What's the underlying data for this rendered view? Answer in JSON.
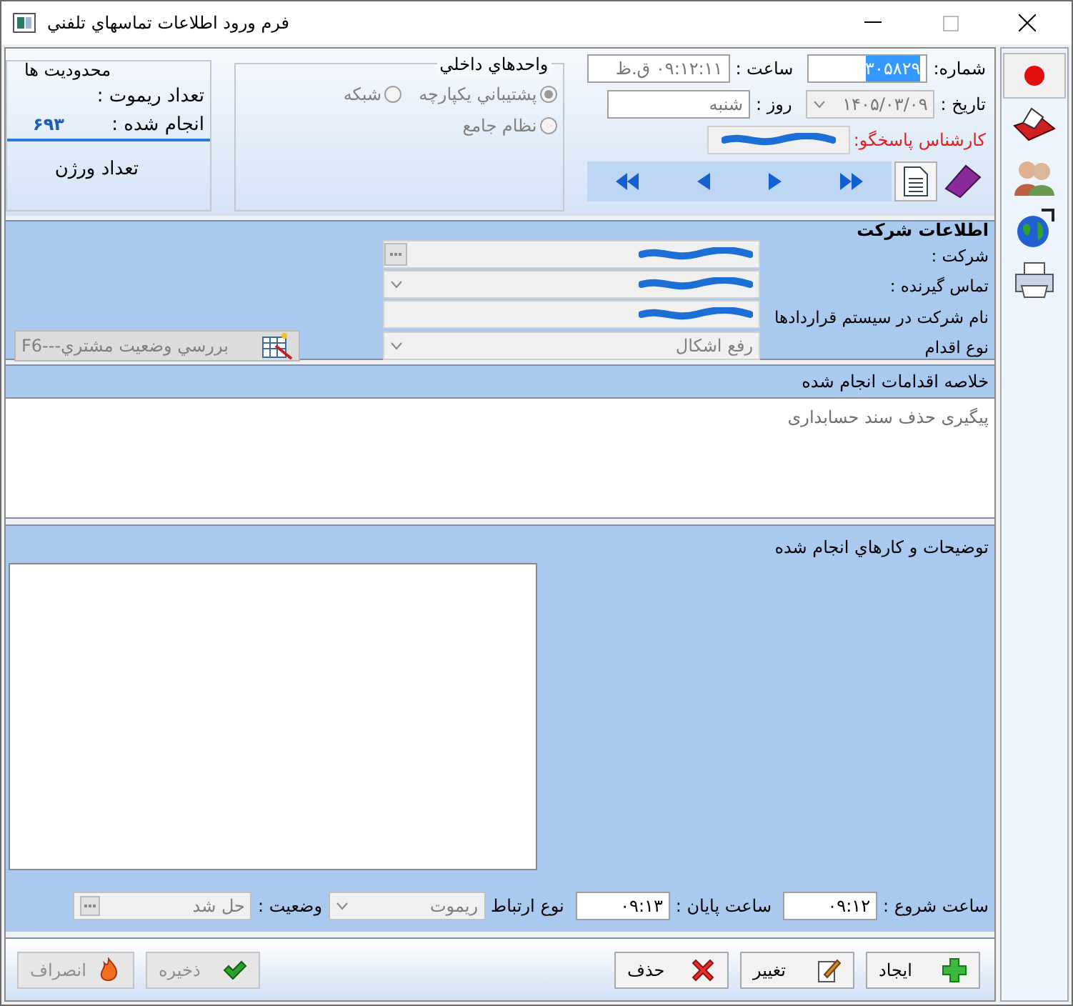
{
  "window": {
    "title": "فرم ورود اطلاعات تماسهاي تلفني"
  },
  "header": {
    "number_label": "شماره:",
    "number": "۳۰۵۸۲۹",
    "time_label": "ساعت :",
    "time": "۰۹:۱۲:۱۱ ق.ظ",
    "date_label": "تاريخ :",
    "date": "۱۴۰۵/۰۳/۰۹",
    "day_label": "روز :",
    "day": "شنبه",
    "expert_label": "كارشناس پاسخگو:"
  },
  "units": {
    "title": "واحدهاي داخلي",
    "options": [
      {
        "label": "پشتيباني يكپارچه",
        "selected": true
      },
      {
        "label": "شبكه",
        "selected": false
      },
      {
        "label": "نظام جامع",
        "selected": false
      }
    ]
  },
  "limits": {
    "title": "محدوديت ها",
    "remote_label": "تعداد ريموت :",
    "done_label": "انجام شده :",
    "done": "۶۹۳",
    "version_label": "تعداد ورژن"
  },
  "company": {
    "title": "اطلاعات شركت",
    "fields": [
      {
        "label": "شركت :",
        "kind": "lookup",
        "redacted": true
      },
      {
        "label": "تماس گيرنده :",
        "kind": "combo",
        "redacted": true
      },
      {
        "label": "نام شركت در سيستم قراردادها",
        "kind": "text",
        "redacted": true
      },
      {
        "label": "نوع اقدام",
        "kind": "combo",
        "value": "رفع اشكال",
        "redacted": false
      }
    ],
    "check_button": "بررسي وضعيت مشتري---F6"
  },
  "summary": {
    "title": "خلاصه اقدامات انجام شده",
    "text": "پيگيری حذف سند حسابداری"
  },
  "description": {
    "title": "توضيحات و كارهاي انجام شده"
  },
  "times": {
    "start_label": "ساعت شروع :",
    "start": "۰۹:۱۲",
    "end_label": "ساعت پايان :",
    "end": "۰۹:۱۳",
    "link_label": "نوع ارتباط",
    "link": "ريموت",
    "status_label": "وضعيت :",
    "status": "حل شد"
  },
  "buttons": [
    {
      "label": "ايجاد",
      "kind": "add",
      "disabled": false
    },
    {
      "label": "تغيير",
      "kind": "edit",
      "disabled": false
    },
    {
      "label": "حذف",
      "kind": "delete",
      "disabled": false
    },
    {
      "label": "ذخيره",
      "kind": "save",
      "disabled": true
    },
    {
      "label": "انصراف",
      "kind": "cancel",
      "disabled": true
    }
  ]
}
